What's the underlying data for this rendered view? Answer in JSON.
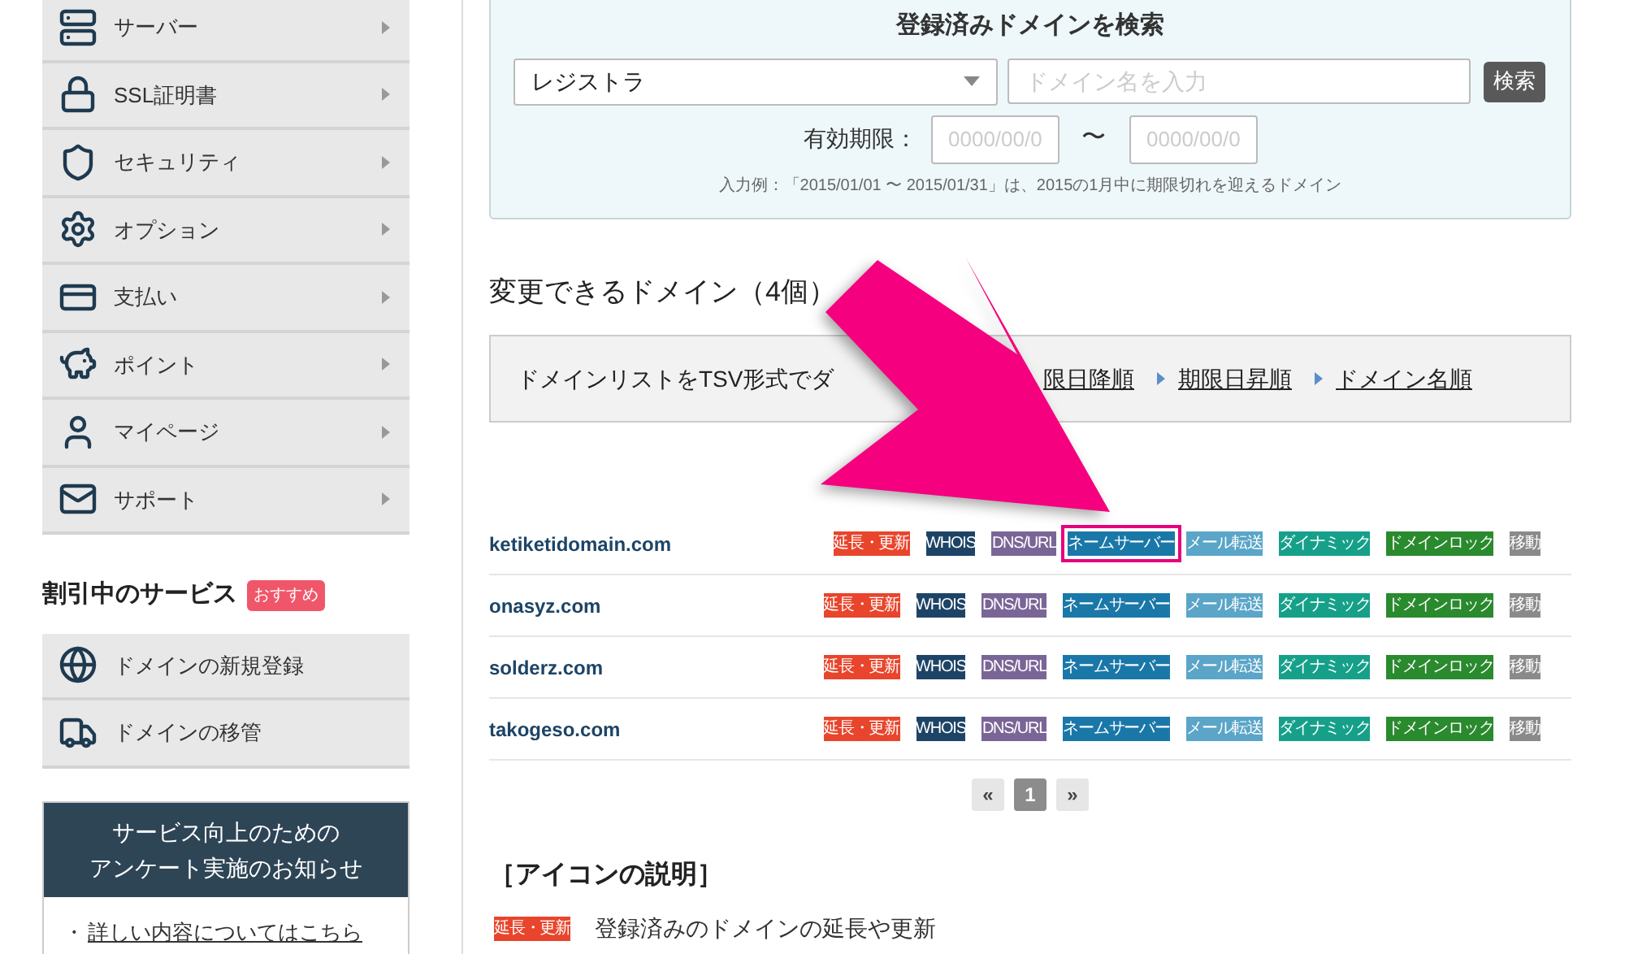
{
  "sidebar": {
    "menu": [
      {
        "label": "サーバー"
      },
      {
        "label": "SSL証明書"
      },
      {
        "label": "セキュリティ"
      },
      {
        "label": "オプション"
      },
      {
        "label": "支払い"
      },
      {
        "label": "ポイント"
      },
      {
        "label": "マイページ"
      },
      {
        "label": "サポート"
      }
    ],
    "discount": {
      "title": "割引中のサービス",
      "badge": "おすすめ",
      "items": [
        {
          "label": "ドメインの新規登録"
        },
        {
          "label": "ドメインの移管"
        }
      ]
    },
    "notice": {
      "title_lines": [
        "サービス向上のための",
        "アンケート実施のお知らせ"
      ],
      "bullet": "・",
      "link": "詳しい内容についてはこちら"
    }
  },
  "search": {
    "title": "登録済みドメインを検索",
    "registrar_select": "レジストラ",
    "domain_input": {
      "placeholder": "ドメイン名を入力"
    },
    "button": "検索",
    "expiry_label": "有効期限：",
    "from": {
      "placeholder": "0000/00/0"
    },
    "separator": "〜",
    "to": {
      "placeholder": "0000/00/0"
    },
    "hint": "入力例：「2015/01/01 〜 2015/01/31」は、2015の1月中に期限切れを迎えるドメイン"
  },
  "domains": {
    "heading": "変更できるドメイン（4個）",
    "toolbar": {
      "text": "ドメインリストをTSV形式でダ",
      "sort_links": [
        "限日降順",
        "期限日昇順",
        "ドメイン名順"
      ]
    },
    "rows": [
      {
        "name": "ketiketidomain.com",
        "actions": [
          {
            "label": "延長・更新",
            "color": "#e8452c",
            "highlighted": false
          },
          {
            "label": "WHOIS",
            "color": "#1d4466",
            "highlighted": false
          },
          {
            "label": "DNS/URL",
            "color": "#7a6597",
            "highlighted": false
          },
          {
            "label": "ネームサーバー",
            "color": "#1a78a8",
            "highlighted": true
          },
          {
            "label": "メール転送",
            "color": "#5aa5c8",
            "highlighted": false
          },
          {
            "label": "ダイナミック",
            "color": "#16a08a",
            "highlighted": false
          },
          {
            "label": "ドメインロック",
            "color": "#2a8a2e",
            "highlighted": false
          },
          {
            "label": "移動",
            "color": "#8a8a8a",
            "highlighted": false
          }
        ]
      },
      {
        "name": "onasyz.com",
        "actions": [
          {
            "label": "延長・更新",
            "color": "#e8452c",
            "highlighted": false
          },
          {
            "label": "WHOIS",
            "color": "#1d4466",
            "highlighted": false
          },
          {
            "label": "DNS/URL",
            "color": "#7a6597",
            "highlighted": false
          },
          {
            "label": "ネームサーバー",
            "color": "#1a78a8",
            "highlighted": false
          },
          {
            "label": "メール転送",
            "color": "#5aa5c8",
            "highlighted": false
          },
          {
            "label": "ダイナミック",
            "color": "#16a08a",
            "highlighted": false
          },
          {
            "label": "ドメインロック",
            "color": "#2a8a2e",
            "highlighted": false
          },
          {
            "label": "移動",
            "color": "#8a8a8a",
            "highlighted": false
          }
        ]
      },
      {
        "name": "solderz.com",
        "actions": [
          {
            "label": "延長・更新",
            "color": "#e8452c",
            "highlighted": false
          },
          {
            "label": "WHOIS",
            "color": "#1d4466",
            "highlighted": false
          },
          {
            "label": "DNS/URL",
            "color": "#7a6597",
            "highlighted": false
          },
          {
            "label": "ネームサーバー",
            "color": "#1a78a8",
            "highlighted": false
          },
          {
            "label": "メール転送",
            "color": "#5aa5c8",
            "highlighted": false
          },
          {
            "label": "ダイナミック",
            "color": "#16a08a",
            "highlighted": false
          },
          {
            "label": "ドメインロック",
            "color": "#2a8a2e",
            "highlighted": false
          },
          {
            "label": "移動",
            "color": "#8a8a8a",
            "highlighted": false
          }
        ]
      },
      {
        "name": "takogeso.com",
        "actions": [
          {
            "label": "延長・更新",
            "color": "#e8452c",
            "highlighted": false
          },
          {
            "label": "WHOIS",
            "color": "#1d4466",
            "highlighted": false
          },
          {
            "label": "DNS/URL",
            "color": "#7a6597",
            "highlighted": false
          },
          {
            "label": "ネームサーバー",
            "color": "#1a78a8",
            "highlighted": false
          },
          {
            "label": "メール転送",
            "color": "#5aa5c8",
            "highlighted": false
          },
          {
            "label": "ダイナミック",
            "color": "#16a08a",
            "highlighted": false
          },
          {
            "label": "ドメインロック",
            "color": "#2a8a2e",
            "highlighted": false
          },
          {
            "label": "移動",
            "color": "#8a8a8a",
            "highlighted": false
          }
        ]
      }
    ],
    "pagination": [
      {
        "label": "«",
        "selected": false
      },
      {
        "label": "1",
        "selected": true
      },
      {
        "label": "»",
        "selected": false
      }
    ]
  },
  "legend": {
    "heading": "［アイコンの説明］",
    "items": [
      {
        "badge": {
          "label": "延長・更新",
          "color": "#e8452c"
        },
        "text": "登録済みのドメインの延長や更新"
      }
    ]
  }
}
